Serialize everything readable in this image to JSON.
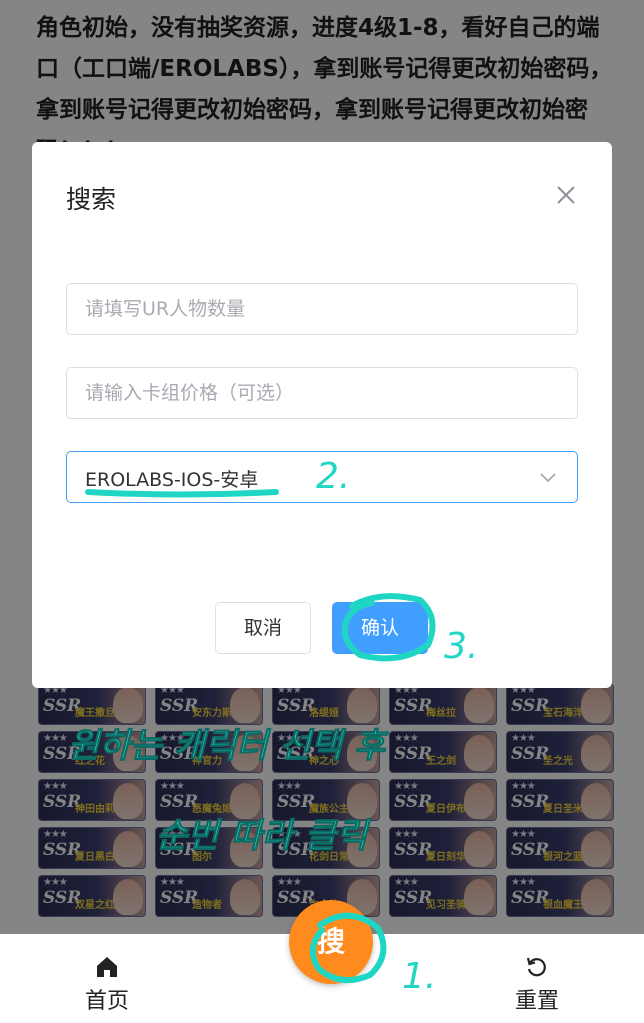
{
  "background": {
    "description_text": "角色初始，没有抽奖资源，进度4级1-8，看好自己的端口（工口端/EROLABS），拿到账号记得更改初始密码，拿到账号记得更改初始密码，拿到账号记得更改初始密码！！！",
    "cards": [
      [
        "魔王撒旦",
        "安东力斯",
        "洛缇娅",
        "梅丝拉",
        "宝石海洋"
      ],
      [
        "红之花",
        "神官力",
        "神之心",
        "王之剑",
        "圣之光"
      ],
      [
        "神田由莉",
        "恶魔兔姬",
        "魔族公主",
        "夏日伊布",
        "夏日圣米娅"
      ],
      [
        "夏日黑白",
        "图尔",
        "花剑日常",
        "夏日刻华",
        "银河之蓝"
      ],
      [
        "双星之红",
        "造物者",
        "生命体",
        "见习圣骑士",
        "银血魔王路德"
      ]
    ],
    "rank_label": "SSR",
    "stars": "★★★"
  },
  "dialog": {
    "title": "搜索",
    "ur_count_placeholder": "请填写UR人物数量",
    "price_placeholder": "请输入卡组价格（可选）",
    "platform_selected": "EROLABS-IOS-安卓",
    "cancel_label": "取消",
    "confirm_label": "确认"
  },
  "bottom_nav": {
    "home_label": "首页",
    "search_label": "搜",
    "reset_label": "重置"
  },
  "annotations": {
    "step1": "1.",
    "step2": "2.",
    "step3": "3.",
    "line1": "원하는 캐릭터 선택 후",
    "line2": "순번 따라 클릭"
  },
  "colors": {
    "primary": "#409eff",
    "fab": "#ff8a1d",
    "annotation": "#1fd6c4",
    "overlay": "rgba(0,0,0,0.48)"
  }
}
